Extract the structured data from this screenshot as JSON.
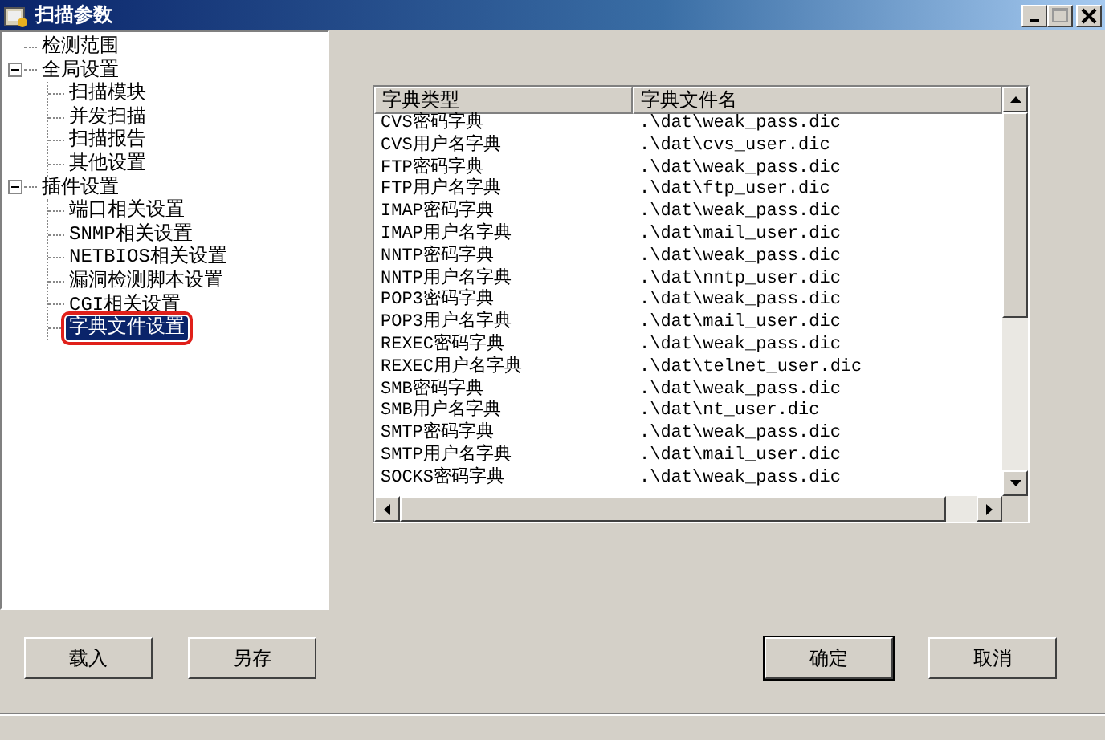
{
  "window": {
    "title": "扫描参数",
    "controls": [
      {
        "kind": "minimize",
        "disabled": false
      },
      {
        "kind": "maximize",
        "disabled": true
      },
      {
        "kind": "close",
        "disabled": false
      }
    ]
  },
  "tree": [
    {
      "label": "检测范围",
      "selected": false
    },
    {
      "label": "全局设置",
      "selected": false,
      "expanded": true,
      "children": [
        {
          "label": "扫描模块",
          "selected": false
        },
        {
          "label": "并发扫描",
          "selected": false
        },
        {
          "label": "扫描报告",
          "selected": false
        },
        {
          "label": "其他设置",
          "selected": false
        }
      ]
    },
    {
      "label": "插件设置",
      "selected": false,
      "expanded": true,
      "children": [
        {
          "label": "端口相关设置",
          "selected": false
        },
        {
          "label": "SNMP相关设置",
          "selected": false
        },
        {
          "label": "NETBIOS相关设置",
          "selected": false
        },
        {
          "label": "漏洞检测脚本设置",
          "selected": false
        },
        {
          "label": "CGI相关设置",
          "selected": false
        },
        {
          "label": "字典文件设置",
          "selected": true
        }
      ]
    }
  ],
  "table": {
    "columns": [
      "字典类型",
      "字典文件名"
    ],
    "rows": [
      [
        "CVS密码字典",
        ".\\dat\\weak_pass.dic"
      ],
      [
        "CVS用户名字典",
        ".\\dat\\cvs_user.dic"
      ],
      [
        "FTP密码字典",
        ".\\dat\\weak_pass.dic"
      ],
      [
        "FTP用户名字典",
        ".\\dat\\ftp_user.dic"
      ],
      [
        "IMAP密码字典",
        ".\\dat\\weak_pass.dic"
      ],
      [
        "IMAP用户名字典",
        ".\\dat\\mail_user.dic"
      ],
      [
        "NNTP密码字典",
        ".\\dat\\weak_pass.dic"
      ],
      [
        "NNTP用户名字典",
        ".\\dat\\nntp_user.dic"
      ],
      [
        "POP3密码字典",
        ".\\dat\\weak_pass.dic"
      ],
      [
        "POP3用户名字典",
        ".\\dat\\mail_user.dic"
      ],
      [
        "REXEC密码字典",
        ".\\dat\\weak_pass.dic"
      ],
      [
        "REXEC用户名字典",
        ".\\dat\\telnet_user.dic"
      ],
      [
        "SMB密码字典",
        ".\\dat\\weak_pass.dic"
      ],
      [
        "SMB用户名字典",
        ".\\dat\\nt_user.dic"
      ],
      [
        "SMTP密码字典",
        ".\\dat\\weak_pass.dic"
      ],
      [
        "SMTP用户名字典",
        ".\\dat\\mail_user.dic"
      ],
      [
        "SOCKS密码字典",
        ".\\dat\\weak_pass.dic"
      ]
    ]
  },
  "buttons_left": [
    {
      "label": "载入",
      "default": false
    },
    {
      "label": "另存",
      "default": false
    }
  ],
  "buttons_right": [
    {
      "label": "确定",
      "default": true
    },
    {
      "label": "取消",
      "default": false
    }
  ]
}
